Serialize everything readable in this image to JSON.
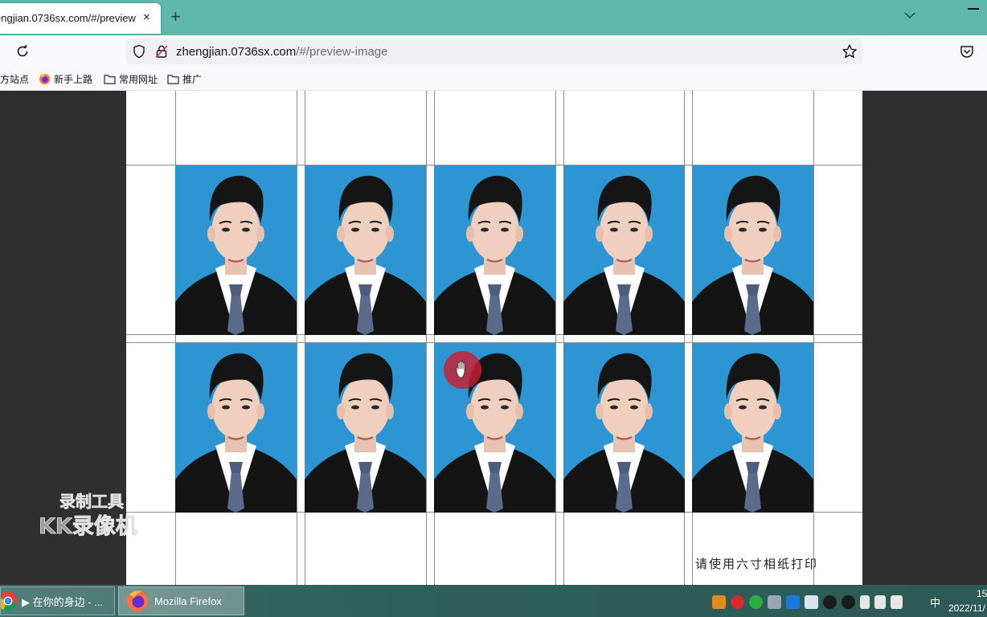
{
  "browser": {
    "tab": {
      "title": "engjian.0736sx.com/#/preview",
      "close": "×"
    },
    "new_tab": "+",
    "url": {
      "host": "zhengjian.0736sx.com",
      "path": "/#/preview-image"
    }
  },
  "bookmarks": [
    {
      "label": "方站点",
      "icon": "none"
    },
    {
      "label": "新手上路",
      "icon": "firefox-icon"
    },
    {
      "label": "常用网址",
      "icon": "folder-icon"
    },
    {
      "label": "推广",
      "icon": "folder-icon"
    }
  ],
  "sheet": {
    "photo_grid": {
      "rows": 2,
      "columns": 5,
      "background_color": "#2e95d3"
    },
    "print_hint": "请使用六寸相纸打印"
  },
  "watermark": {
    "line1": "录制工具",
    "line2": "KK录像机"
  },
  "taskbar": {
    "items": [
      {
        "label": "▶ 在你的身边 - ...",
        "icon": "chrome-icon"
      },
      {
        "label": "Mozilla Firefox",
        "icon": "firefox-icon",
        "active": true
      }
    ],
    "ime": "中",
    "clock_time": "15",
    "clock_date": "2022/11/"
  },
  "colors": {
    "tab_bar": "#5fb8aa",
    "photo_bg": "#2e95d3",
    "cursor_highlight": "#c81e32"
  }
}
